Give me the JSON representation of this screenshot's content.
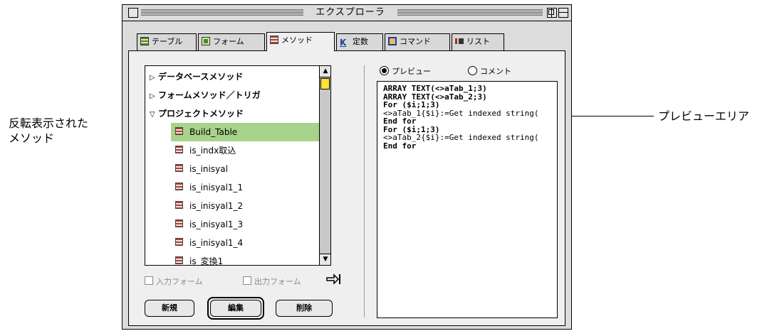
{
  "window": {
    "title": "エクスプローラ"
  },
  "tabs": [
    {
      "label": "テーブル",
      "icon": "table-icon",
      "selected": false
    },
    {
      "label": "フォーム",
      "icon": "form-icon",
      "selected": false
    },
    {
      "label": "メソッド",
      "icon": "method-icon",
      "selected": true
    },
    {
      "label": "定数",
      "icon": "constant-k-icon",
      "selected": false
    },
    {
      "label": "コマンド",
      "icon": "command-icon",
      "selected": false
    },
    {
      "label": "リスト",
      "icon": "list-icon",
      "selected": false
    }
  ],
  "tree": {
    "folders": [
      {
        "label": "データベースメソッド",
        "expanded": false
      },
      {
        "label": "フォームメソッド／トリガ",
        "expanded": false
      },
      {
        "label": "プロジェクトメソッド",
        "expanded": true
      }
    ],
    "methods": [
      {
        "label": "Build_Table",
        "selected": true
      },
      {
        "label": "is_indx取込",
        "selected": false
      },
      {
        "label": "is_inisyal",
        "selected": false
      },
      {
        "label": "is_inisyal1_1",
        "selected": false
      },
      {
        "label": "is_inisyal1_2",
        "selected": false
      },
      {
        "label": "is_inisyal1_3",
        "selected": false
      },
      {
        "label": "is_inisyal1_4",
        "selected": false
      },
      {
        "label": "is_変換1",
        "selected": false
      }
    ]
  },
  "checkboxes": {
    "input_form": "入力フォーム",
    "output_form": "出力フォーム"
  },
  "buttons": {
    "new": "新規",
    "edit": "編集",
    "delete": "削除"
  },
  "preview_options": {
    "preview": "プレビュー",
    "comment": "コメント",
    "selected": "preview"
  },
  "preview_code": [
    {
      "text": "ARRAY TEXT(<>aTab_1;3)",
      "bold": true
    },
    {
      "text": "ARRAY TEXT(<>aTab_2;3)",
      "bold": true
    },
    {
      "text": "For ($i;1;3)",
      "bold": true
    },
    {
      "text": " <>aTab_1{$i}:=Get indexed string(",
      "bold": false
    },
    {
      "text": "End for",
      "bold": true
    },
    {
      "text": "For ($i;1;3)",
      "bold": true
    },
    {
      "text": " <>aTab_2{$i}:=Get indexed string(",
      "bold": false
    },
    {
      "text": "End for",
      "bold": true
    }
  ],
  "callouts": {
    "left_line1": "反転表示された",
    "left_line2": "メソッド",
    "right": "プレビューエリア"
  },
  "colors": {
    "selection": "#a8d38a",
    "scroll_thumb": "#ffe234"
  }
}
